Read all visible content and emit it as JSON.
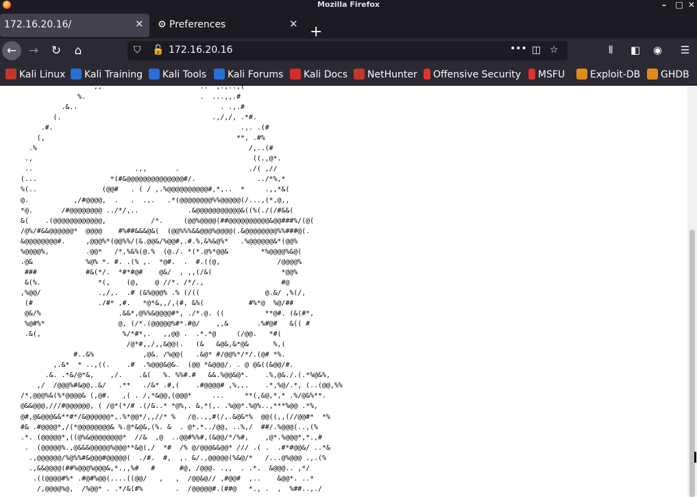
{
  "window": {
    "title": "Mozilla Firefox"
  },
  "tabs": [
    {
      "label": "172.16.20.16/"
    },
    {
      "label": "Preferences"
    }
  ],
  "urlbar": {
    "url": "172.16.20.16"
  },
  "bookmarks": [
    {
      "label": "Kali Linux",
      "icon": "kali-dragon-icon",
      "color": "#c0392b"
    },
    {
      "label": "Kali Training",
      "icon": "kali-training-icon",
      "color": "#2b6fd6"
    },
    {
      "label": "Kali Tools",
      "icon": "kali-tools-icon",
      "color": "#2b6fd6"
    },
    {
      "label": "Kali Forums",
      "icon": "kali-forums-icon",
      "color": "#2b6fd6"
    },
    {
      "label": "Kali Docs",
      "icon": "kali-docs-icon",
      "color": "#d62b2b"
    },
    {
      "label": "NetHunter",
      "icon": "nethunter-icon",
      "color": "#c0392b"
    },
    {
      "label": "Offensive Security",
      "icon": "offsec-icon",
      "color": "#e0332b"
    },
    {
      "label": "MSFU",
      "icon": "msfu-icon",
      "color": "#e0332b"
    },
    {
      "label": "Exploit-DB",
      "icon": "exploit-db-icon",
      "color": "#e08a1a"
    },
    {
      "label": "GHDB",
      "icon": "ghdb-icon",
      "color": "#e08a1a"
    }
  ],
  "page": {
    "ascii_art": "                  ,,                        ..  ,.,..,(\n              %.                            .  ...,,.#\n          .&..                                   . .,.#\n        (.                                     .,/,/, .*#.\n     .#.                                              .,. .(#\n    (,                                               **, .#%\n  .%                                                    /,..(#\n .,                                                      ((.,@*.\n ..                         .,,       .                 ./( ,//\n(...                  *(#&@@@@@@@@@@@@@@#/.               ../*%,*\n%(..                (@@#   . ( / ,.%@@@@@@@@@@#,*,..  *     .,,*&(\n@.           ,/#@@@@,  .   .  .,.   .*(@@@@@@@@%%@@@@@(/...,(*,@,,\n*@.       /#@@@@@@@@ ../*/,..            .&@@@@@@@@@@@&((%(./(/#&&(\n&(    .(@@@@@@@@@@@@,           /*.     (@@%@@@@(##@@@@@@@@@@&@@###%/(@(\n/@%/#&&@@@@@@*  @@@@    #%##&&&@&(  (@@%%%&&@@@%@@@@(.&@@@@@@@@%%###@(.\n&@@@@@@@@#.     ,@@@%*(@@%%/(&.@@&/%@@#,.#.%,&%&@%*   .%@@@@@@&*(@@%\n%@@@@%,         .@@*   /*,%&%(@.%  (@./. *(*.@%*@@&        *%@@@@%&@(\n.@&             %@% *. #. .(% ,.  *@#.  .  #.((@,              /@@@@%\n ###            #&(*/.  *#*#@#    @&/  , ,,(/&(                 *@@%\n &(%.              *(,    (@,    @ //*. /*/.,                   #@\n,%@@/              .,/,.  .# (&%@@@% .% (/((                @.&/ ,%(/,\n (#                ./#* ,#.   *@*&,,/,(#, &%(           #%*@  %@/##\n @&/%                   .&&*,@%%&@@@@#*, ./*.@. ((          **@#. (&(#*,\n %@#%*                  @, (/*.(@@@@@%#*.#@/    ,,&       .%#@#   &(( #\n .&(,                    %/*#*,.   ,,@@ .  .*.*@     (/@@.   *#(\n                          /@*#,,/,,&@@(.   (&   &@&,&*@&      %,(\n             #..&%            ,@&. /%@@(   .&@* #/@@%*/*/.(@# *%.\n        ,.&*  * ..,((.    .#  .%@@@&@&.  (@@ *&@@@/. . @ @&((&@@/#.\n      .&. .*&/@*&,    ,/.    .&(   %. %%#.#   &&.%@@&@*.    .%,@&./.(.*%@&%,\n    ,/  /@@@%#&@@,.&/   .**   ./&* .#,(    .#@@@@# ,%,,.    .*,%@/.*, (..(@@,%%\n/*,@@@%&(%*@@@@& (,@#.   ,( . /,*&@@,(@@@*     ...     **(,&@,*,* .%/@&%**.\n@&&@@@,///#@@@@@@, ( /@*(*/# .(/&..* *@%,. &,*(,. .%@@*.%@%..,***%@@ .*%,\n@#,@&@@@&&**#*/&@@@@@@*,.%*@@*/,,//* %   /@..,,#(/,.&@&*%  @@((,,(//@@#*  *%\n#& .#@@@@*,/(*@@@@@@@@& %.@*&@&,(%. &  . @*.*../@@, ..%,/  ##/.%@@@(..,(%\n.*. (@@@@@*,((@%&@@@@@@@@*  //&  ,@  ..@@#%%#,(&@@/*/%#,    ,@*.%@@@*,*.,#\n .  (@@@@@%.,@&&&@@@@@%@@@**&@(,/  *#  /% @/@@@&&@@* /// .( .  .#*#@@&/ ..*&\n  .,@@@@@@/%@%%#&@@@#@@@@@(  ./#.  #,  ,. &/.,@@@@@(%&@/*   /...@%@@@ .,.(%\n  .,&&@@@@(##%@@@%@@@&,*.,,%#   #      #@, /@@@. .,,  . .*.  &@@@.. ,*/\n   .((@@@@#%* .#@#%@@(....((@@/   ,   ,  /@@&@// ,#@@#  ,..    &@@*. ..*\n    /,@@@@%@,  /%@@* . .*/&(#%        .  /@@@@@#.(##@   *., .  ,  %##..,./"
  }
}
